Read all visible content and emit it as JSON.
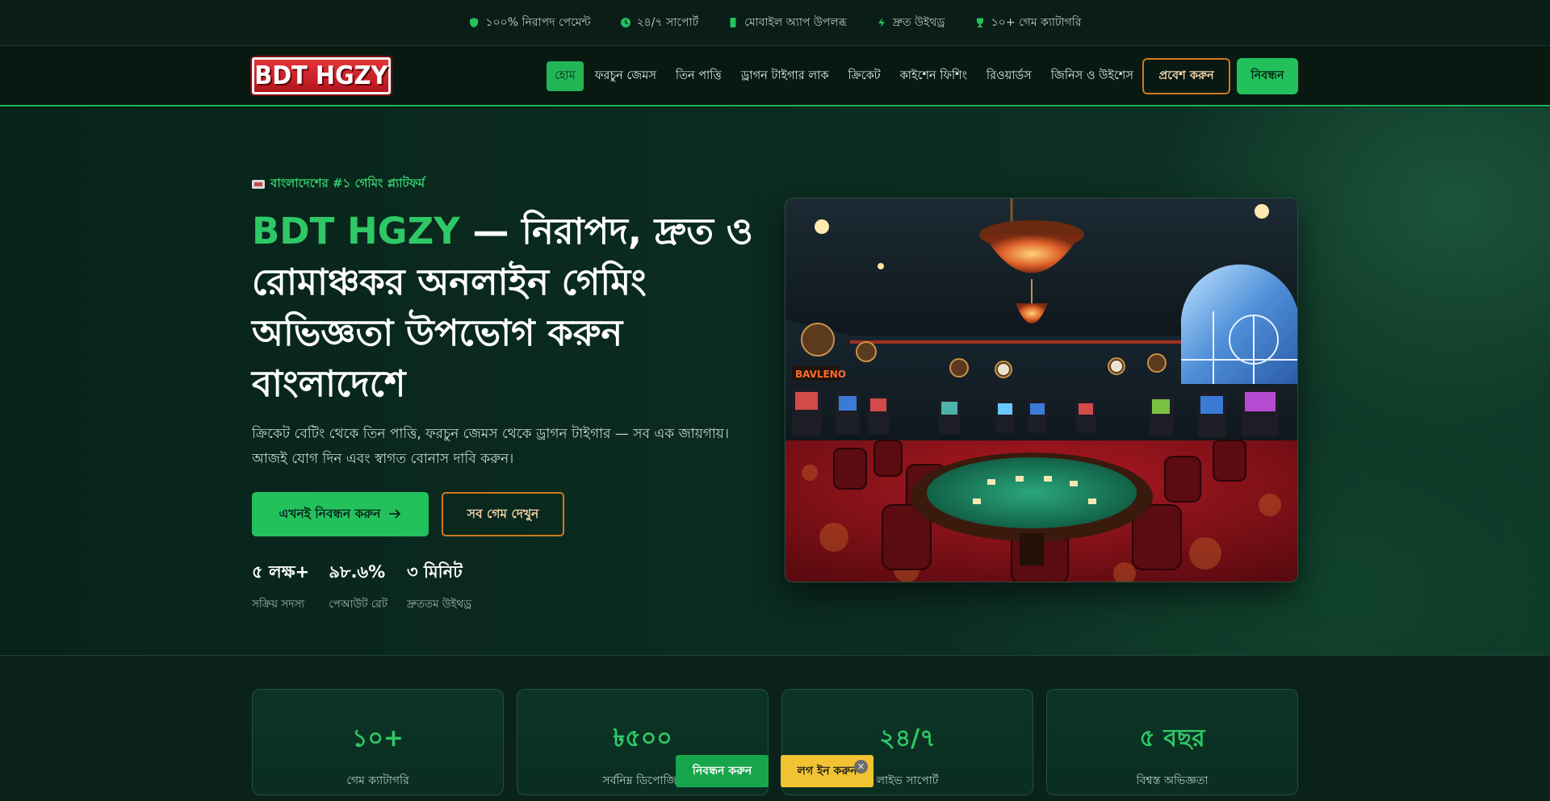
{
  "topbar": {
    "items": [
      {
        "icon": "shield-icon",
        "label": "১০০% নিরাপদ পেমেন্ট"
      },
      {
        "icon": "clock-icon",
        "label": "২৪/৭ সাপোর্ট"
      },
      {
        "icon": "mobile-icon",
        "label": "মোবাইল অ্যাপ উপলব্ধ"
      },
      {
        "icon": "bolt-icon",
        "label": "দ্রুত উইথড্র"
      },
      {
        "icon": "trophy-icon",
        "label": "১০+ গেম ক্যাটাগরি"
      }
    ]
  },
  "header": {
    "logo_text": "BDT HGZY",
    "nav": [
      {
        "label": "হোম",
        "active": true
      },
      {
        "label": "ফরচুন জেমস"
      },
      {
        "label": "তিন পাত্তি"
      },
      {
        "label": "ড্রাগন টাইগার লাক"
      },
      {
        "label": "ক্রিকেট"
      },
      {
        "label": "কাইশেন ফিশিং"
      },
      {
        "label": "রিওয়ার্ডস"
      },
      {
        "label": "জিনিস ও উইশেস"
      }
    ],
    "login_label": "প্রবেশ করুন",
    "register_label": "নিবন্ধন"
  },
  "hero": {
    "badge": "বাংলাদেশের #১ গেমিং প্ল্যাটফর্ম",
    "title_brand": "BDT HGZY",
    "title_rest": " — নিরাপদ, দ্রুত ও রোমাঞ্চকর অনলাইন গেমিং অভিজ্ঞতা উপভোগ করুন বাংলাদেশে",
    "description": "ক্রিকেট বেটিং থেকে তিন পাত্তি, ফরচুন জেমস থেকে ড্রাগন টাইগার — সব এক জায়গায়। আজই যোগ দিন এবং স্বাগত বোনাস দাবি করুন।",
    "primary_cta": "এখনই নিবন্ধন করুন",
    "secondary_cta": "সব গেম দেখুন",
    "stats": [
      {
        "value": "৫ লক্ষ+",
        "label": "সক্রিয় সদস্য"
      },
      {
        "value": "৯৮.৬%",
        "label": "পেআউট রেট"
      },
      {
        "value": "৩ মিনিট",
        "label": "দ্রুততম উইথড্র"
      }
    ],
    "image_sign": "BAVLENO"
  },
  "features": [
    {
      "value": "১০+",
      "label": "গেম ক্যাটাগরি"
    },
    {
      "value": "৳৫০০",
      "label": "সর্বনিম্ন ডিপোজিট"
    },
    {
      "value": "২৪/৭",
      "label": "লাইভ সাপোর্ট"
    },
    {
      "value": "৫ বছর",
      "label": "বিশ্বস্ত অভিজ্ঞতা"
    }
  ],
  "sticky": {
    "register_label": "নিবন্ধন করুন",
    "login_label": "লগ ইন করুন",
    "close_glyph": "×"
  },
  "colors": {
    "accent_green": "#22c15b",
    "accent_orange": "#d07a1d",
    "sticky_yellow": "#f1c232",
    "page_bg": "#0a1f18"
  }
}
